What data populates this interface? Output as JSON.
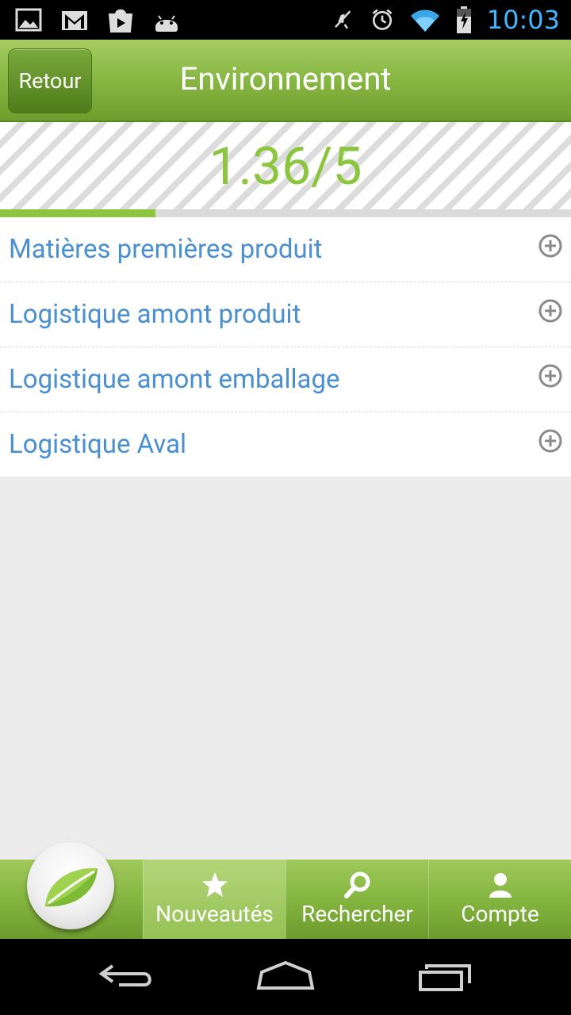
{
  "status_bar": {
    "time": "10:03",
    "left_icons": [
      "image-icon",
      "gmail-icon",
      "play-store-icon",
      "android-icon"
    ],
    "right_icons": [
      "muted-icon",
      "alarm-icon",
      "wifi-icon",
      "battery-charging-icon"
    ],
    "accent": "#45b4ff"
  },
  "header": {
    "back_label": "Retour",
    "title": "Environnement"
  },
  "score": {
    "value_text": "1.36/5",
    "fraction": 0.272,
    "color": "#8cc63f"
  },
  "list": {
    "items": [
      {
        "label": "Matières premières produit"
      },
      {
        "label": "Logistique amont produit"
      },
      {
        "label": "Logistique amont emballage"
      },
      {
        "label": "Logistique Aval"
      }
    ]
  },
  "tabs": {
    "items": [
      {
        "label": "Nouveautés",
        "icon": "star-icon",
        "active": true
      },
      {
        "label": "Rechercher",
        "icon": "search-icon",
        "active": false
      },
      {
        "label": "Compte",
        "icon": "user-icon",
        "active": false
      }
    ]
  },
  "navbar": {
    "icons": [
      "back-icon",
      "home-icon",
      "recent-apps-icon"
    ]
  }
}
